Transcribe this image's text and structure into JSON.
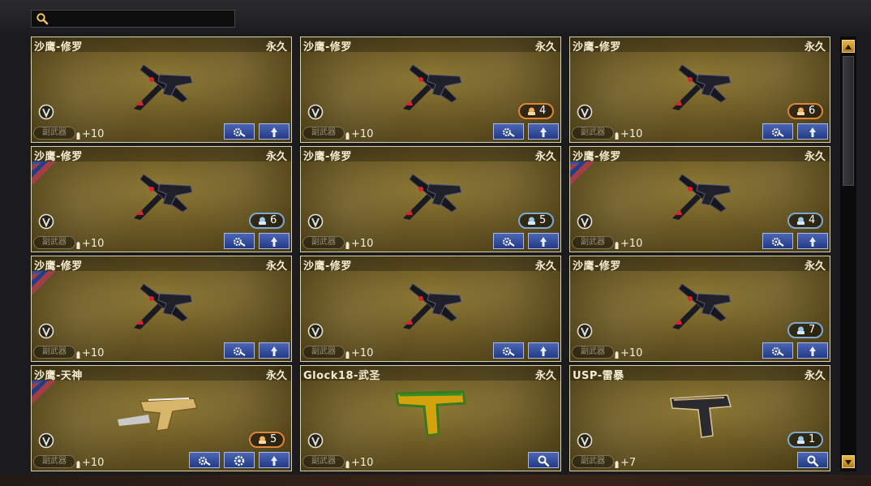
{
  "search": {
    "placeholder": "",
    "value": ""
  },
  "cards": [
    {
      "name": "沙鹰-修罗",
      "duration": "永久",
      "type": "副武器",
      "ammo": "+10",
      "badge": null,
      "corner": false,
      "buttons": [
        "gear",
        "up"
      ]
    },
    {
      "name": "沙鹰-修罗",
      "duration": "永久",
      "type": "副武器",
      "ammo": "+10",
      "badge": {
        "kind": "orange",
        "count": "4"
      },
      "corner": false,
      "buttons": [
        "gear",
        "up"
      ]
    },
    {
      "name": "沙鹰-修罗",
      "duration": "永久",
      "type": "副武器",
      "ammo": "+10",
      "badge": {
        "kind": "orange",
        "count": "6"
      },
      "corner": false,
      "buttons": [
        "gear",
        "up"
      ]
    },
    {
      "name": "沙鹰-修罗",
      "duration": "永久",
      "type": "副武器",
      "ammo": "+10",
      "badge": {
        "kind": "blue",
        "count": "6"
      },
      "corner": true,
      "buttons": [
        "gear",
        "up"
      ]
    },
    {
      "name": "沙鹰-修罗",
      "duration": "永久",
      "type": "副武器",
      "ammo": "+10",
      "badge": {
        "kind": "blue",
        "count": "5"
      },
      "corner": false,
      "buttons": [
        "gear",
        "up"
      ]
    },
    {
      "name": "沙鹰-修罗",
      "duration": "永久",
      "type": "副武器",
      "ammo": "+10",
      "badge": {
        "kind": "blue",
        "count": "4"
      },
      "corner": true,
      "buttons": [
        "gear",
        "up"
      ]
    },
    {
      "name": "沙鹰-修罗",
      "duration": "永久",
      "type": "副武器",
      "ammo": "+10",
      "badge": null,
      "corner": true,
      "buttons": [
        "gear",
        "up"
      ]
    },
    {
      "name": "沙鹰-修罗",
      "duration": "永久",
      "type": "副武器",
      "ammo": "+10",
      "badge": null,
      "corner": false,
      "buttons": [
        "gear",
        "up"
      ]
    },
    {
      "name": "沙鹰-修罗",
      "duration": "永久",
      "type": "副武器",
      "ammo": "+10",
      "badge": {
        "kind": "blue",
        "count": "7"
      },
      "corner": false,
      "buttons": [
        "gear",
        "up"
      ]
    },
    {
      "name": "沙鹰-天神",
      "duration": "永久",
      "type": "副武器",
      "ammo": "+10",
      "badge": {
        "kind": "orange",
        "count": "5"
      },
      "corner": true,
      "buttons": [
        "gear",
        "gear2",
        "up"
      ]
    },
    {
      "name": "Glock18-武圣",
      "duration": "永久",
      "type": "副武器",
      "ammo": "+10",
      "badge": null,
      "corner": false,
      "buttons": [
        "search"
      ]
    },
    {
      "name": "USP-雷暴",
      "duration": "永久",
      "type": "副武器",
      "ammo": "+7",
      "badge": {
        "kind": "blue",
        "count": "1"
      },
      "corner": false,
      "buttons": [
        "search"
      ]
    }
  ],
  "colors": {
    "card_border": "#d9d2ae",
    "button_blue": "#2f4a9a",
    "badge_orange": "#e0843a",
    "badge_blue": "#7ea8d2",
    "scroll_gold": "#d9a63a"
  },
  "icons": {
    "search": "magnifier-icon",
    "gear": "gear-wrench-icon",
    "up": "arrow-up-icon",
    "v": "v-emblem-icon"
  }
}
